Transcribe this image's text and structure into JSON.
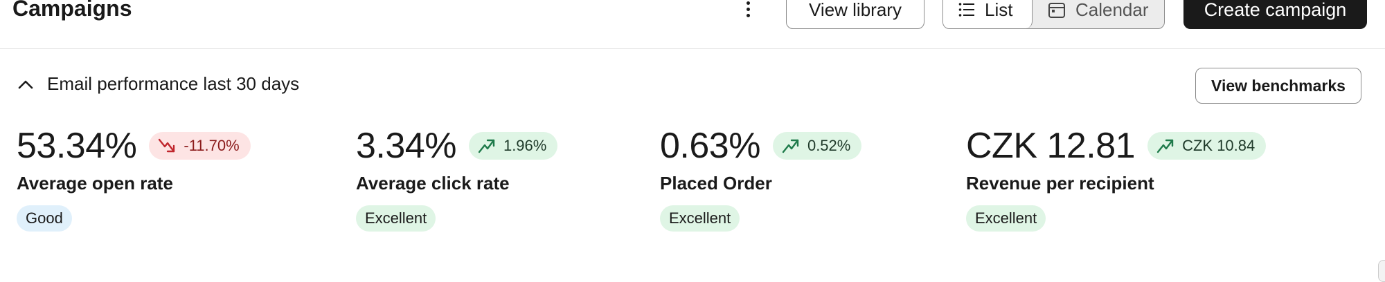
{
  "header": {
    "title": "Campaigns",
    "more_icon": "more-vertical-icon",
    "view_library_label": "View library",
    "view_toggle": {
      "list_label": "List",
      "calendar_label": "Calendar",
      "selected": "List"
    },
    "create_label": "Create campaign"
  },
  "performance": {
    "collapse_icon": "chevron-up-icon",
    "title": "Email performance last 30 days",
    "benchmarks_label": "View benchmarks",
    "metrics": [
      {
        "value": "53.34%",
        "delta": "-11.70%",
        "trend": "down",
        "label": "Average open rate",
        "rating": "Good"
      },
      {
        "value": "3.34%",
        "delta": "1.96%",
        "trend": "up",
        "label": "Average click rate",
        "rating": "Excellent"
      },
      {
        "value": "0.63%",
        "delta": "0.52%",
        "trend": "up",
        "label": "Placed Order",
        "rating": "Excellent"
      },
      {
        "value": "CZK 12.81",
        "delta": "CZK 10.84",
        "trend": "up",
        "label": "Revenue per recipient",
        "rating": "Excellent"
      }
    ]
  },
  "colors": {
    "primary_button": "#1a1a1a",
    "trend_up_bg": "#dff5e5",
    "trend_up_icon": "#1e7a4a",
    "trend_down_bg": "#fde4e4",
    "trend_down_icon": "#c0262d",
    "rating_good_bg": "#e0f0fb",
    "rating_excellent_bg": "#dff5e5"
  }
}
